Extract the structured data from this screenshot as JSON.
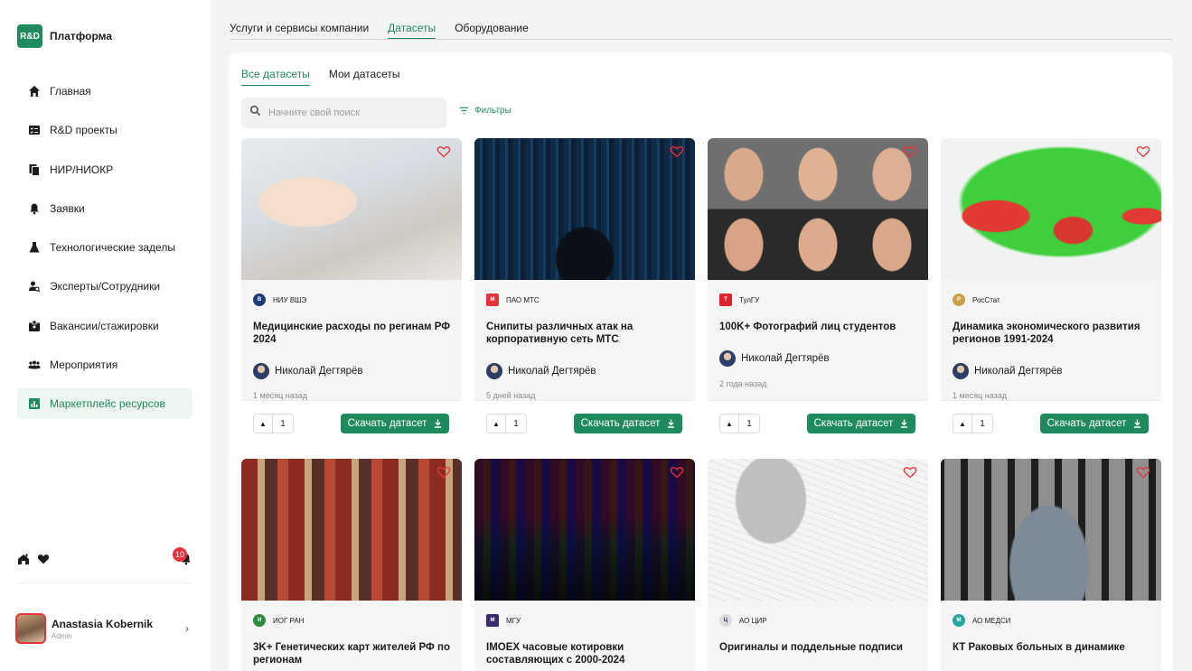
{
  "brand": {
    "logo": "R&D",
    "name": "Платформа"
  },
  "nav": [
    {
      "label": "Главная",
      "icon": "home-icon"
    },
    {
      "label": "R&D проекты",
      "icon": "projects-icon"
    },
    {
      "label": "НИР/НИОКР",
      "icon": "documents-icon"
    },
    {
      "label": "Заявки",
      "icon": "bell-icon"
    },
    {
      "label": "Технологические заделы",
      "icon": "flask-icon"
    },
    {
      "label": "Эксперты/Сотрудники",
      "icon": "user-search-icon"
    },
    {
      "label": "Вакансии/стажировки",
      "icon": "badge-icon"
    },
    {
      "label": "Мероприятия",
      "icon": "group-icon"
    },
    {
      "label": "Маркетплейс ресурсов",
      "icon": "chart-icon",
      "active": true
    }
  ],
  "notifications": {
    "count": "10"
  },
  "user": {
    "name": "Anastasia Kobernik",
    "role": "Admin"
  },
  "top_tabs": [
    "Услуги и сервисы компании",
    "Датасеты",
    "Оборудование"
  ],
  "sub_tabs": [
    "Все датасеты",
    "Мои датасеты"
  ],
  "search": {
    "placeholder": "Начните свой поиск"
  },
  "filters_label": "Фильтры",
  "download_label": "Скачать датасет",
  "accent": "#1f8a5b",
  "cards": [
    {
      "org": "НИУ ВШЭ",
      "title": "Медицинские расходы по регинам РФ 2024",
      "author": "Николай Дегтярёв",
      "time": "1 месяц назад",
      "votes": "1"
    },
    {
      "org": "ПАО МТС",
      "title": "Снипиты различных атак на корпоративную сеть МТС",
      "author": "Николай Дегтярёв",
      "time": "5 дней назад",
      "votes": "1"
    },
    {
      "org": "ТулГУ",
      "title": "100K+ Фотографий лиц студентов",
      "author": "Николай Дегтярёв",
      "time": "2 года назад",
      "votes": "1"
    },
    {
      "org": "РосСтат",
      "title": "Динамика экономического развития регионов 1991-2024",
      "author": "Николай Дегтярёв",
      "time": "1 месяц назад",
      "votes": "1"
    },
    {
      "org": "ИОГ РАН",
      "title": "3K+ Генетических карт жителей РФ по регионам"
    },
    {
      "org": "МГУ",
      "title": "IMOEX часовые котировки составляющих с 2000-2024"
    },
    {
      "org": "АО ЦИР",
      "title": "Оригиналы и поддельные подписи"
    },
    {
      "org": "АО МЕДСИ",
      "title": "КТ Раковых больных в динамике"
    }
  ]
}
